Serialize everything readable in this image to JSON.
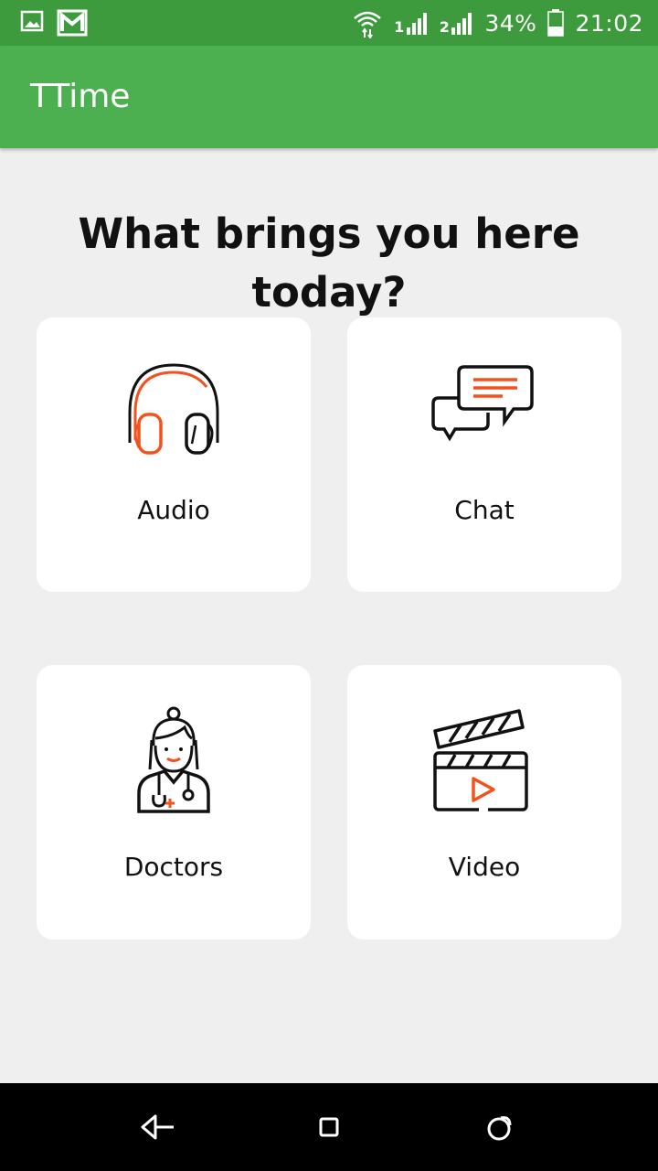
{
  "status_bar": {
    "battery_percent": "34%",
    "time": "21:02",
    "sim1_label": "1",
    "sim2_label": "2",
    "icons": [
      "image-notification-icon",
      "gmail-icon",
      "wifi-icon",
      "signal-icon",
      "battery-icon"
    ]
  },
  "app_bar": {
    "title": "TTime"
  },
  "main": {
    "question": "What brings you here today?",
    "options": [
      {
        "label": "Audio",
        "icon": "headphones-icon"
      },
      {
        "label": "Chat",
        "icon": "chat-bubbles-icon"
      },
      {
        "label": "Doctors",
        "icon": "doctor-icon"
      },
      {
        "label": "Video",
        "icon": "clapperboard-icon"
      }
    ]
  },
  "colors": {
    "status_bar": "#3d9b3e",
    "app_bar": "#4caf50",
    "accent": "#f4511e",
    "background": "#efefef",
    "card": "#ffffff"
  },
  "nav_bar": {
    "icons": [
      "back-icon",
      "home-icon",
      "recents-icon"
    ]
  }
}
